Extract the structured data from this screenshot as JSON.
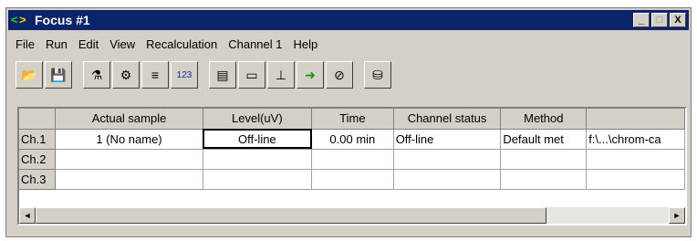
{
  "window": {
    "title": "Focus #1"
  },
  "titlebar_buttons": {
    "minimize": "_",
    "maximize": "□",
    "close": "X"
  },
  "menu": [
    "File",
    "Run",
    "Edit",
    "View",
    "Recalculation",
    "Channel 1",
    "Help"
  ],
  "toolbar": [
    {
      "name": "open-icon",
      "glyph": "📂"
    },
    {
      "name": "save-icon",
      "glyph": "💾"
    },
    {
      "sep": true
    },
    {
      "name": "method-icon",
      "glyph": "⚗"
    },
    {
      "name": "calibration-icon",
      "glyph": "⚙"
    },
    {
      "name": "chromatogram-icon",
      "glyph": "≡"
    },
    {
      "name": "table-icon",
      "glyph": "123"
    },
    {
      "sep": true
    },
    {
      "name": "report-icon",
      "glyph": "▤"
    },
    {
      "name": "monitor-icon",
      "glyph": "▭"
    },
    {
      "name": "instrument-icon",
      "glyph": "⊥"
    },
    {
      "name": "run-arrow-icon",
      "glyph": "➜"
    },
    {
      "name": "stop-icon",
      "glyph": "⊘"
    },
    {
      "sep": true
    },
    {
      "name": "sequence-icon",
      "glyph": "⛁"
    }
  ],
  "grid": {
    "columns": [
      "",
      "Actual sample",
      "Level(uV)",
      "Time",
      "Channel status",
      "Method",
      ""
    ],
    "rows": [
      [
        "Ch.1",
        "1 (No name)",
        "Off-line",
        "0.00 min",
        "Off-line",
        "Default met",
        "f:\\...\\chrom-ca"
      ],
      [
        "Ch.2",
        "",
        "",
        "",
        "",
        "",
        ""
      ],
      [
        "Ch.3",
        "",
        "",
        "",
        "",
        "",
        ""
      ]
    ]
  },
  "scrollbar": {
    "left": "◄",
    "right": "►"
  }
}
